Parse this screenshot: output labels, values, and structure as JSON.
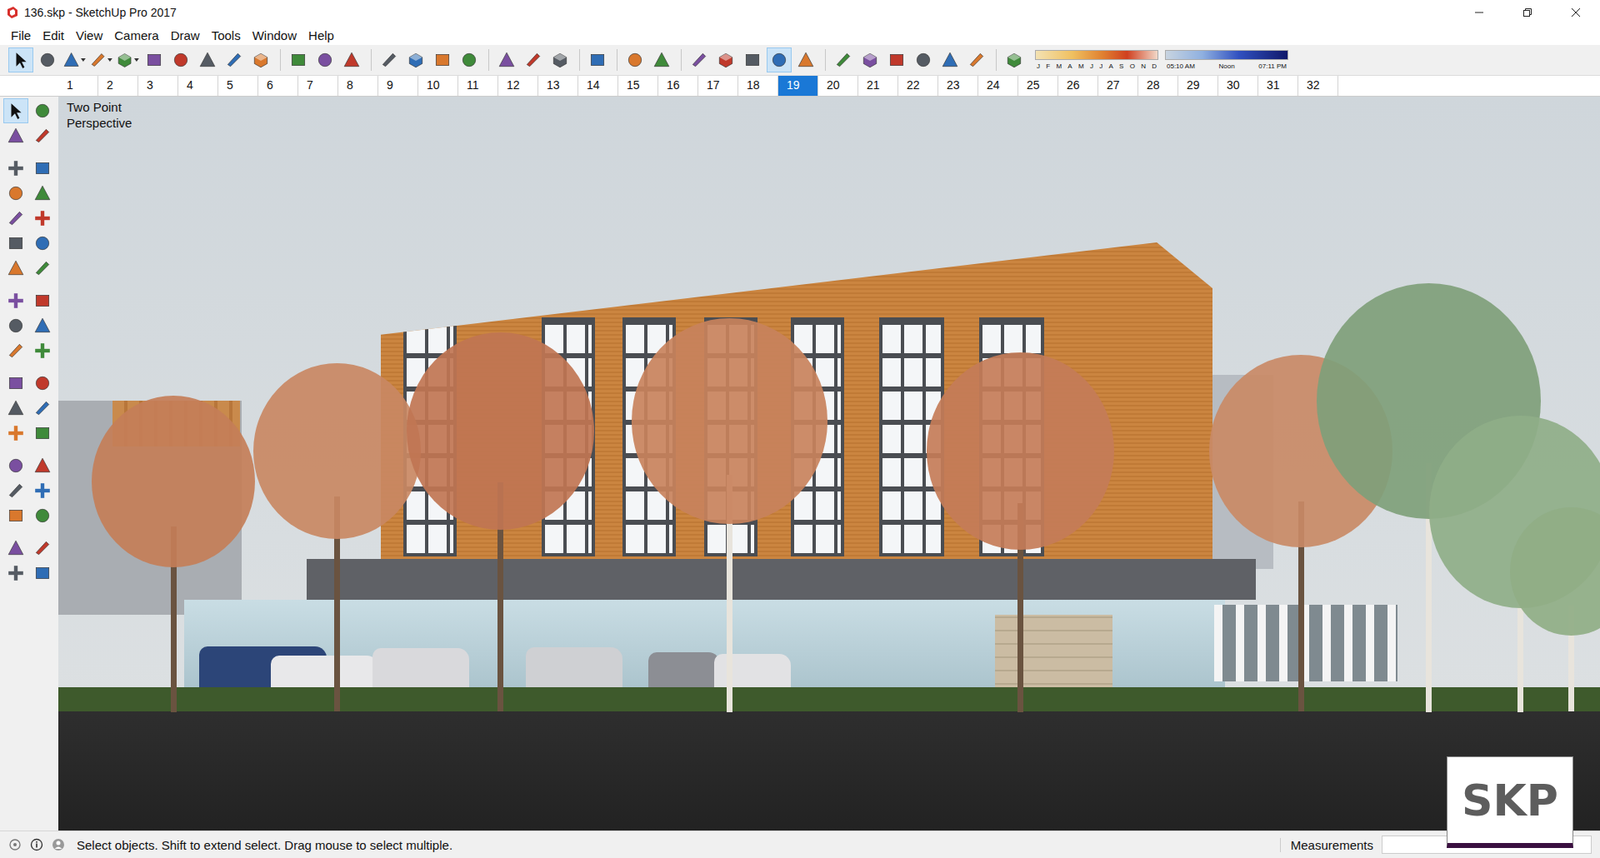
{
  "window": {
    "title": "136.skp - SketchUp Pro 2017"
  },
  "menu": [
    "File",
    "Edit",
    "View",
    "Camera",
    "Draw",
    "Tools",
    "Window",
    "Help"
  ],
  "main_toolbar": [
    {
      "selected": true,
      "dropdown": false
    },
    {
      "selected": false,
      "dropdown": false
    },
    {
      "selected": false,
      "dropdown": true
    },
    {
      "selected": false,
      "dropdown": true
    },
    {
      "selected": false,
      "dropdown": true
    },
    {
      "selected": false,
      "dropdown": false
    },
    {
      "selected": false,
      "dropdown": false
    },
    {
      "selected": false,
      "dropdown": false
    },
    {
      "selected": false,
      "dropdown": false
    },
    {
      "selected": false,
      "dropdown": false
    },
    {
      "selected": false,
      "dropdown": false
    },
    {
      "selected": false,
      "dropdown": false
    },
    {
      "selected": false,
      "dropdown": false
    },
    {
      "selected": false,
      "dropdown": false
    },
    {
      "selected": false,
      "dropdown": false
    },
    {
      "selected": false,
      "dropdown": false
    },
    {
      "selected": false,
      "dropdown": false
    },
    {
      "selected": false,
      "dropdown": false
    },
    {
      "selected": false,
      "dropdown": false
    },
    {
      "selected": false,
      "dropdown": false
    },
    {
      "selected": false,
      "dropdown": false
    },
    {
      "selected": false,
      "dropdown": false
    },
    {
      "selected": false,
      "dropdown": false
    },
    {
      "selected": false,
      "dropdown": false
    },
    {
      "selected": false,
      "dropdown": false
    },
    {
      "selected": false,
      "dropdown": false
    },
    {
      "selected": true,
      "dropdown": false
    },
    {
      "selected": false,
      "dropdown": false
    },
    {
      "selected": false,
      "dropdown": false
    },
    {
      "selected": false,
      "dropdown": false
    },
    {
      "selected": false,
      "dropdown": false
    },
    {
      "selected": false,
      "dropdown": false
    },
    {
      "selected": false,
      "dropdown": false
    },
    {
      "selected": false,
      "dropdown": false
    },
    {
      "selected": false,
      "dropdown": false
    }
  ],
  "shadows": {
    "months": [
      "J",
      "F",
      "M",
      "A",
      "M",
      "J",
      "J",
      "A",
      "S",
      "O",
      "N",
      "D"
    ],
    "times": [
      "05:10 AM",
      "Noon",
      "07:11 PM"
    ]
  },
  "scene_tabs": [
    {
      "label": "1",
      "selected": false
    },
    {
      "label": "2",
      "selected": false
    },
    {
      "label": "3",
      "selected": false
    },
    {
      "label": "4",
      "selected": false
    },
    {
      "label": "5",
      "selected": false
    },
    {
      "label": "6",
      "selected": false
    },
    {
      "label": "7",
      "selected": false
    },
    {
      "label": "8",
      "selected": false
    },
    {
      "label": "9",
      "selected": false
    },
    {
      "label": "10",
      "selected": false
    },
    {
      "label": "11",
      "selected": false
    },
    {
      "label": "12",
      "selected": false
    },
    {
      "label": "13",
      "selected": false
    },
    {
      "label": "14",
      "selected": false
    },
    {
      "label": "15",
      "selected": false
    },
    {
      "label": "16",
      "selected": false
    },
    {
      "label": "17",
      "selected": false
    },
    {
      "label": "18",
      "selected": false
    },
    {
      "label": "19",
      "selected": true
    },
    {
      "label": "20",
      "selected": false
    },
    {
      "label": "21",
      "selected": false
    },
    {
      "label": "22",
      "selected": false
    },
    {
      "label": "23",
      "selected": false
    },
    {
      "label": "24",
      "selected": false
    },
    {
      "label": "25",
      "selected": false
    },
    {
      "label": "26",
      "selected": false
    },
    {
      "label": "27",
      "selected": false
    },
    {
      "label": "28",
      "selected": false
    },
    {
      "label": "29",
      "selected": false
    },
    {
      "label": "30",
      "selected": false
    },
    {
      "label": "31",
      "selected": false
    },
    {
      "label": "32",
      "selected": false
    }
  ],
  "left_toolbar": [
    {
      "selected": true
    },
    {
      "selected": false
    },
    {
      "selected": false
    },
    {
      "selected": false
    },
    {
      "selected": false
    },
    {
      "selected": false
    },
    {
      "selected": false
    },
    {
      "selected": false
    },
    {
      "selected": false
    },
    {
      "selected": false
    },
    {
      "selected": false
    },
    {
      "selected": false
    },
    {
      "selected": false
    },
    {
      "selected": false
    },
    {
      "selected": false
    },
    {
      "selected": false
    },
    {
      "selected": false
    },
    {
      "selected": false
    },
    {
      "selected": false
    },
    {
      "selected": false
    },
    {
      "selected": false
    },
    {
      "selected": false
    },
    {
      "selected": false
    },
    {
      "selected": false
    },
    {
      "selected": false
    },
    {
      "selected": false
    },
    {
      "selected": false
    },
    {
      "selected": false
    },
    {
      "selected": false
    },
    {
      "selected": false
    },
    {
      "selected": false
    },
    {
      "selected": false
    },
    {
      "selected": false
    },
    {
      "selected": false
    },
    {
      "selected": false
    },
    {
      "selected": false
    }
  ],
  "viewport": {
    "camera_label": [
      "Two Point",
      "Perspective"
    ]
  },
  "watermark": "SKP",
  "status_bar": {
    "message": "Select objects. Shift to extend select. Drag mouse to select multiple.",
    "measurements_label": "Measurements"
  }
}
